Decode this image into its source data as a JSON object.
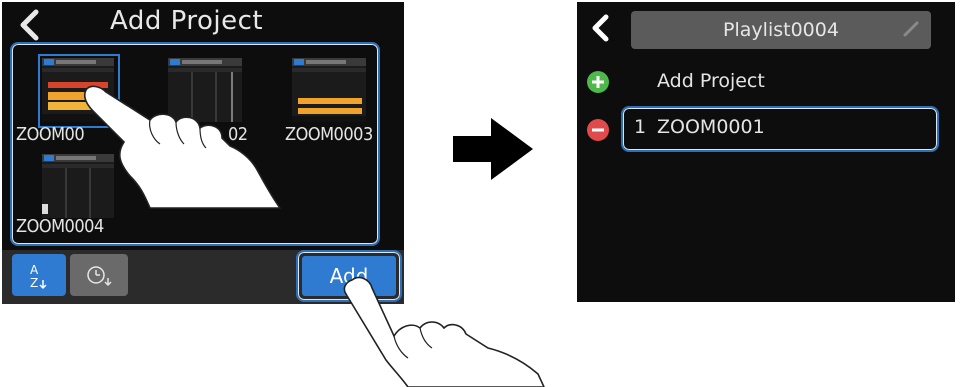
{
  "left_screen": {
    "title": "Add Project",
    "projects": [
      {
        "name": "ZOOM0001"
      },
      {
        "name": "ZOOM0002"
      },
      {
        "name": "ZOOM0003"
      },
      {
        "name": "ZOOM0004"
      }
    ],
    "visible_labels": [
      "ZOOM00",
      "02",
      "ZOOM0003",
      "ZOOM0004"
    ],
    "add_button": "Add",
    "sort_az_icon": "sort-alpha-icon",
    "sort_time_icon": "sort-clock-icon"
  },
  "right_screen": {
    "playlist_name": "Playlist0004",
    "add_project_label": "Add Project",
    "items": [
      {
        "number": "1",
        "name": "ZOOM0001"
      }
    ]
  },
  "colors": {
    "accent_blue": "#2e7bd1",
    "highlight_frame": "#2f6fb5",
    "add_green": "#4fb84a",
    "remove_red": "#e14a4a",
    "screen_bg": "#0d0d0d"
  }
}
